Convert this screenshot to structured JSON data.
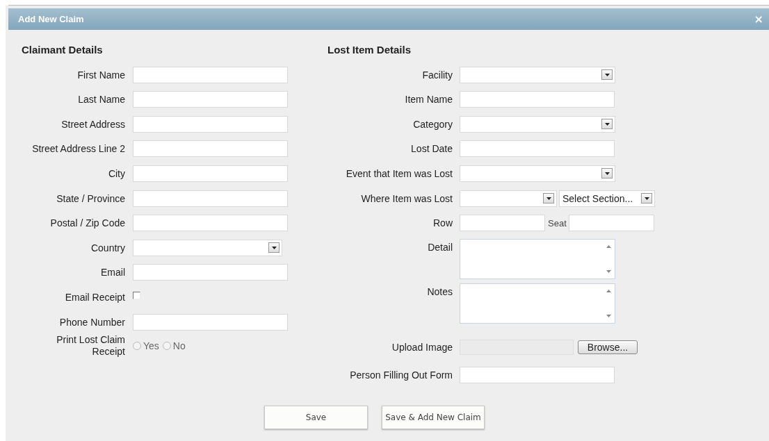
{
  "dialog": {
    "title": "Add New Claim",
    "close": "×"
  },
  "sections": [
    {
      "heading": "Claimant Details",
      "fields": [
        {
          "kind": "text",
          "label": "First Name"
        },
        {
          "kind": "text",
          "label": "Last Name"
        },
        {
          "kind": "text",
          "label": "Street Address"
        },
        {
          "kind": "text",
          "label": "Street Address Line 2"
        },
        {
          "kind": "text",
          "label": "City"
        },
        {
          "kind": "text",
          "label": "State / Province"
        },
        {
          "kind": "text",
          "label": "Postal / Zip Code"
        },
        {
          "kind": "select",
          "label": "Country"
        },
        {
          "kind": "text",
          "label": "Email"
        },
        {
          "kind": "checkbox",
          "label": "Email Receipt",
          "checked": false
        },
        {
          "kind": "text",
          "label": "Phone Number"
        },
        {
          "kind": "radio",
          "label": "Print Lost Claim Receipt",
          "options": [
            {
              "label": "Yes",
              "selected": false
            },
            {
              "label": "No",
              "selected": false
            }
          ]
        }
      ]
    },
    {
      "heading": "Lost Item Details",
      "fields": [
        {
          "kind": "select",
          "label": "Facility"
        },
        {
          "kind": "text",
          "label": "Item Name"
        },
        {
          "kind": "select",
          "label": "Category"
        },
        {
          "kind": "text",
          "label": "Lost Date"
        },
        {
          "kind": "select",
          "label": "Event that Item was Lost"
        },
        {
          "kind": "double-select",
          "label": "Where Item was Lost",
          "second_value": "Select Section..."
        },
        {
          "kind": "pair",
          "label": "Row",
          "second_label": "Seat"
        },
        {
          "kind": "textarea",
          "label": "Detail"
        },
        {
          "kind": "textarea",
          "label": "Notes"
        },
        {
          "kind": "file",
          "label": "Upload Image",
          "button": "Browse..."
        },
        {
          "kind": "text",
          "label": "Person Filling Out Form"
        }
      ]
    }
  ],
  "buttons": [
    "Save",
    "Save & Add New Claim"
  ]
}
